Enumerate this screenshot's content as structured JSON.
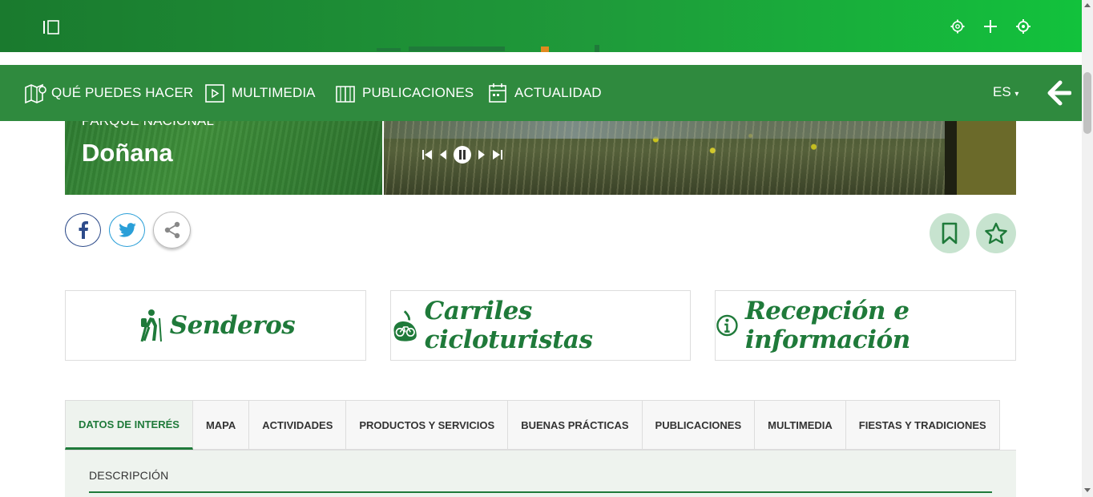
{
  "topbar": {
    "icons": [
      "menu-toggle-icon",
      "gear-icon",
      "plus-icon",
      "crosshair-icon"
    ]
  },
  "nav": {
    "items": [
      {
        "label": "QUÉ PUEDES HACER",
        "icon": "map-pin-icon"
      },
      {
        "label": "MULTIMEDIA",
        "icon": "play-icon"
      },
      {
        "label": "PUBLICACIONES",
        "icon": "book-icon"
      },
      {
        "label": "ACTUALIDAD",
        "icon": "calendar-icon"
      }
    ],
    "language": "ES",
    "back_icon": "arrow-left-icon"
  },
  "hero": {
    "kicker": "PARQUE NACIONAL",
    "title": "Doñana",
    "controls": [
      "first-icon",
      "prev-icon",
      "pause-icon",
      "next-icon",
      "last-icon"
    ]
  },
  "share": [
    "facebook-icon",
    "twitter-icon",
    "share-icon"
  ],
  "actions": [
    "bookmark-icon",
    "star-icon"
  ],
  "features": [
    {
      "label": "Senderos",
      "icon": "hiker-icon"
    },
    {
      "label": "Carriles cicloturistas",
      "icon": "bicycle-icon"
    },
    {
      "label": "Recepción e información",
      "icon": "info-icon"
    }
  ],
  "tabs": [
    "DATOS DE INTERÉS",
    "MAPA",
    "ACTIVIDADES",
    "PRODUCTOS Y SERVICIOS",
    "BUENAS PRÁCTICAS",
    "PUBLICACIONES",
    "MULTIMEDIA",
    "FIESTAS Y TRADICIONES"
  ],
  "active_tab": "DATOS DE INTERÉS",
  "panel": {
    "title": "DESCRIPCIÓN"
  },
  "colors": {
    "brand_green": "#1f7a3a",
    "nav_green": "#2f8a3e",
    "action_bg": "#c7e3cf"
  }
}
